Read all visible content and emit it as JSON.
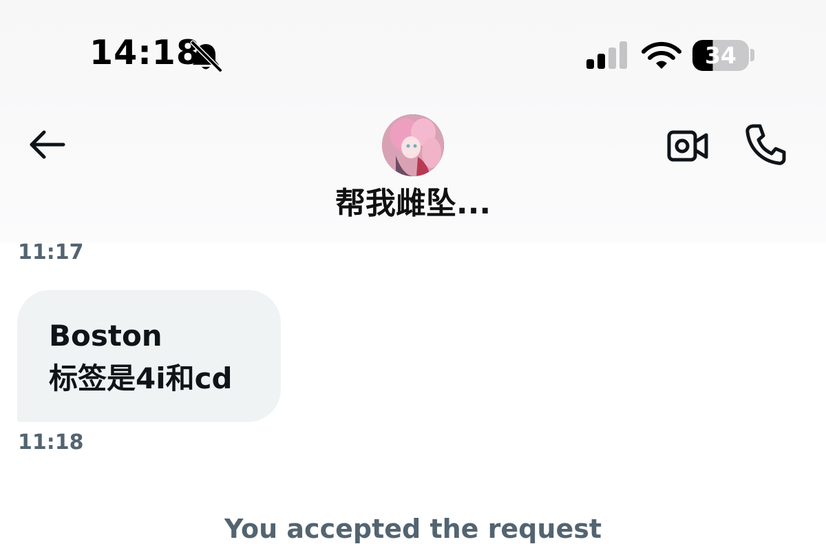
{
  "status_bar": {
    "time": "14:18",
    "battery_level": "34",
    "icons": [
      "bell-slash-icon",
      "cellular-signal-icon",
      "wifi-icon",
      "battery-icon"
    ]
  },
  "header": {
    "contact_name": "帮我雌坠...",
    "icons": [
      "back-arrow-icon",
      "avatar",
      "video-call-icon",
      "phone-call-icon"
    ]
  },
  "messages": [
    {
      "timestamp": "11:17"
    },
    {
      "lines": [
        "Boston",
        "标签是4i和cd"
      ],
      "timestamp": "11:18"
    }
  ],
  "system_message": "You accepted the request",
  "colors": {
    "bubble_background": "#eff3f4",
    "timestamp_text": "#536471",
    "primary_text": "#0f1419"
  }
}
